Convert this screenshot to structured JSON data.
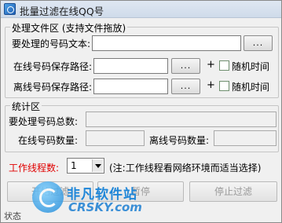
{
  "window": {
    "title": "批量过滤在线QQ号"
  },
  "file_group": {
    "label": "处理文件区 (支持文件拖放)",
    "input_file": {
      "label": "要处理的号码文本:",
      "value": "",
      "browse": "..."
    },
    "online_path": {
      "label": "在线号码保存路径:",
      "value": "",
      "browse": "...",
      "plus": "+",
      "random_label": "随机时间",
      "random_checked": false
    },
    "offline_path": {
      "label": "离线号码保存路径:",
      "value": "",
      "browse": "...",
      "plus": "+",
      "random_label": "随机时间",
      "random_checked": false
    }
  },
  "stats_group": {
    "label": "统计区",
    "total_label": "要处理号码总数:",
    "total_value": "",
    "online_label": "在线号码数量:",
    "online_value": "",
    "offline_label": "离线号码数量:",
    "offline_value": ""
  },
  "threads": {
    "label": "工作线程数:",
    "value": "1",
    "note": "(注:工作线程看网络环境而适当选择)",
    "label_color": "#e00000"
  },
  "buttons": {
    "start": "开始过滤",
    "pause": "暂停",
    "stop": "停止过滤"
  },
  "watermark": {
    "cn": "非凡软件站",
    "en": "CRSKY.com"
  },
  "status": {
    "text": "状态"
  }
}
